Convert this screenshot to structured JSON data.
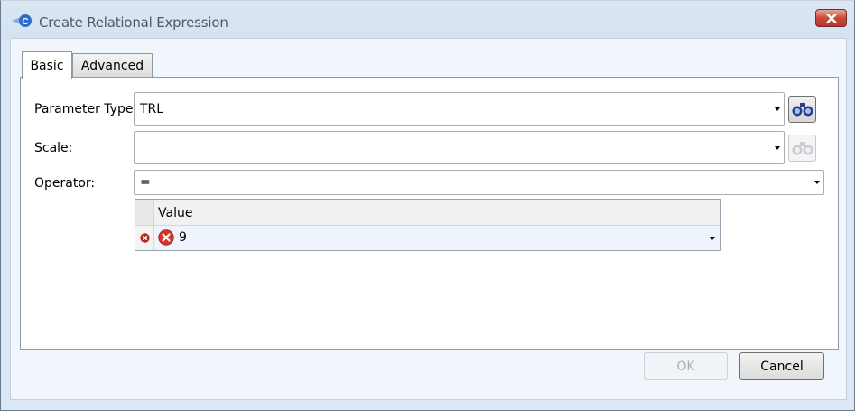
{
  "window": {
    "title": "Create Relational Expression",
    "colors": {
      "frame": "#dbe7f4",
      "client": "#f0f6fc",
      "close": "#c8493b"
    }
  },
  "tabs": [
    {
      "label": "Basic",
      "selected": true
    },
    {
      "label": "Advanced",
      "selected": false
    }
  ],
  "form": {
    "parameter_type": {
      "label": "Parameter Type:",
      "value": "TRL"
    },
    "scale": {
      "label": "Scale:",
      "value": ""
    },
    "operator": {
      "label": "Operator:",
      "value": "="
    }
  },
  "grid": {
    "column_header": "Value",
    "rows": [
      {
        "value": "9",
        "has_error": true
      }
    ]
  },
  "buttons": {
    "ok": "OK",
    "cancel": "Cancel"
  }
}
